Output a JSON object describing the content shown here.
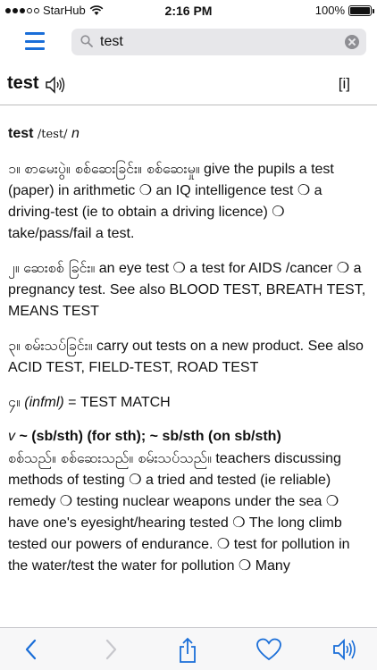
{
  "status": {
    "carrier": "StarHub",
    "time": "2:16 PM",
    "battery": "100%",
    "battery_level": 1.0
  },
  "search": {
    "value": "test",
    "placeholder": ""
  },
  "header": {
    "headword": "test",
    "info_label": "[i]"
  },
  "entry": {
    "headword": "test",
    "pronunciation": "/test/",
    "pos": "n",
    "senses": [
      {
        "num": "၁။",
        "myanmar": "စာမေးပွဲ။ စစ်ဆေးခြင်း။ စစ်ဆေးမှု။",
        "english": " give the pupils a test (paper) in arithmetic ❍ an IQ intelligence test ❍ a driving-test (ie to obtain a driving licence) ❍ take/pass/fail a test."
      },
      {
        "num": "၂။",
        "myanmar": "ဆေးစစ် ခြင်း။",
        "english": " an eye test ❍ a test for AIDS /cancer ❍ a pregnancy test. See also BLOOD TEST, BREATH TEST, MEANS TEST"
      },
      {
        "num": "၃။",
        "myanmar": "စမ်းသပ်ခြင်း။",
        "english": " carry out tests on a new product. See also ACID TEST, FIELD-TEST, ROAD TEST"
      },
      {
        "num": "၄။",
        "infml": "(infml)",
        "english": " = TEST MATCH"
      }
    ],
    "verb": {
      "pos": "v",
      "pattern": " ~ (sb/sth) (for sth); ~ sb/sth (on sb/sth)",
      "myanmar": "စစ်သည်။ စစ်ဆေးသည်။ စမ်းသပ်သည်။",
      "english": " teachers discussing methods of testing ❍ a tried and tested (ie reliable) remedy ❍ testing nuclear weapons under the sea ❍ have one's eyesight/hearing tested ❍ The long climb tested our powers of endurance. ❍ test for pollution in the water/test the water for pollution ❍ Many"
    }
  },
  "icons": {
    "menu": "menu-icon",
    "search": "search-icon",
    "clear": "clear-icon",
    "speaker": "speaker-icon",
    "back": "chevron-left-icon",
    "forward": "chevron-right-icon",
    "share": "share-icon",
    "favorite": "heart-icon"
  },
  "colors": {
    "accent": "#1a6ed8",
    "disabled": "#c7c7cc"
  }
}
